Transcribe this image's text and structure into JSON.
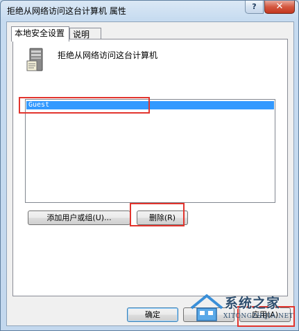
{
  "window": {
    "title": "拒绝从网络访问这台计算机 属性",
    "help_glyph": "?",
    "close_glyph": "✕"
  },
  "tabs": [
    {
      "label": "本地安全设置",
      "active": true
    },
    {
      "label": "说明",
      "active": false
    }
  ],
  "policy": {
    "icon": "server-computer-icon",
    "title": "拒绝从网络访问这台计算机"
  },
  "accounts": {
    "items": [
      "Guest"
    ],
    "selected": "Guest"
  },
  "buttons": {
    "add_user": "添加用户或组(U)...",
    "remove": "删除(R)",
    "ok": "确定",
    "cancel": "取消",
    "apply": "应用(A)"
  },
  "watermark": {
    "brand": "系统之家",
    "url": "XITONGZHIJIA.NET",
    "icon": "house-logo-icon"
  },
  "colors": {
    "selection": "#3399ff",
    "annotation": "#e2342d"
  }
}
